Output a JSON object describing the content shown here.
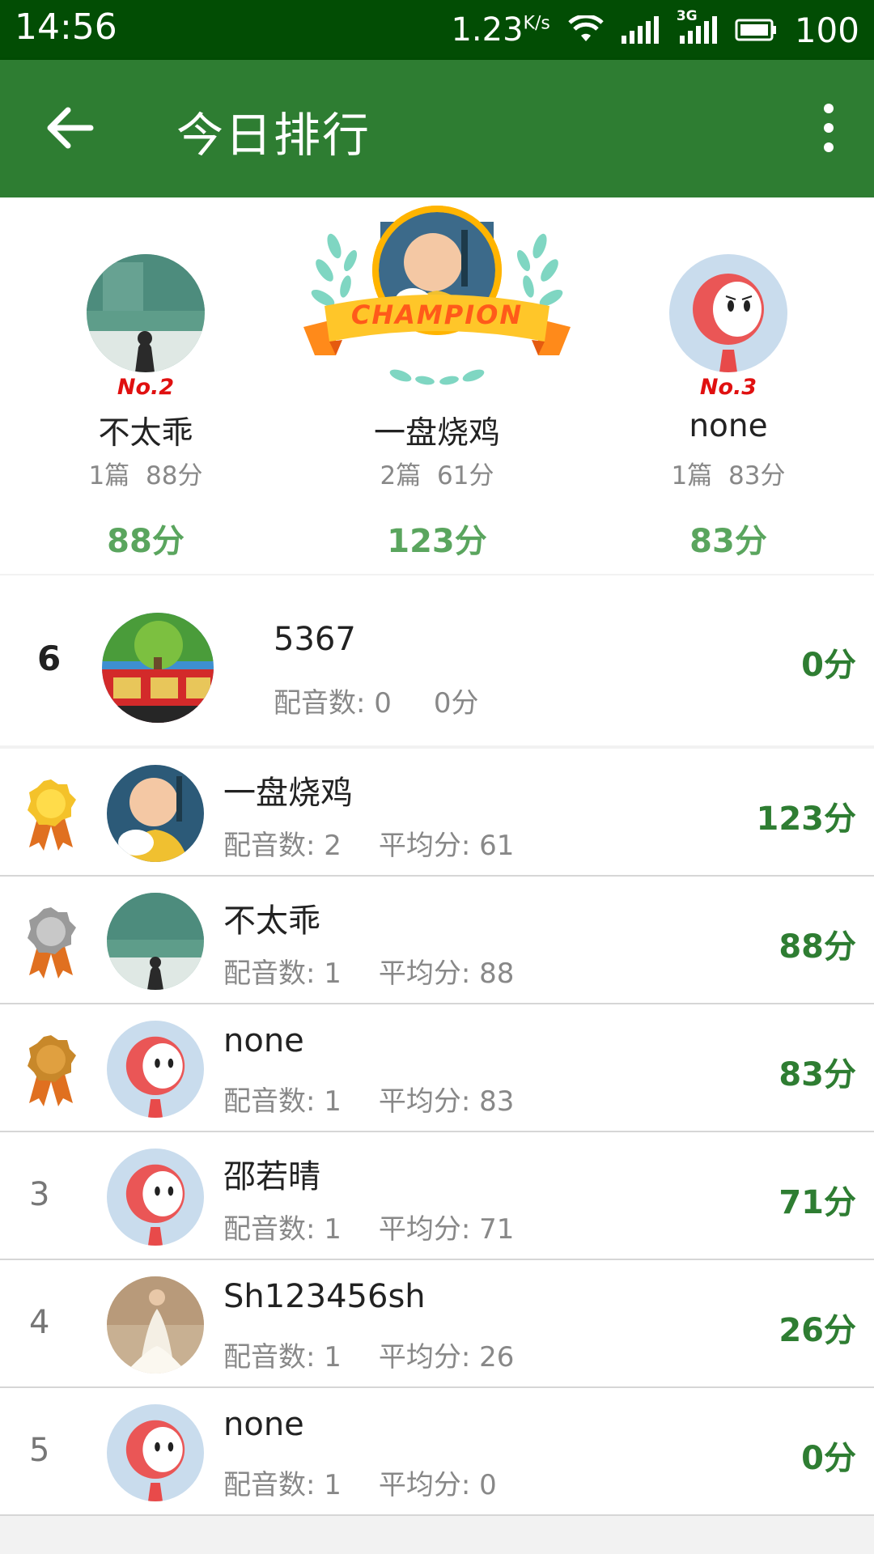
{
  "status_bar": {
    "time": "14:56",
    "net_speed": "1.23",
    "net_speed_unit": "K/s",
    "network_type": "3G",
    "battery": "100",
    "icons": [
      "wifi-icon",
      "signal-icon",
      "signal-3g-icon",
      "battery-icon"
    ]
  },
  "app_bar": {
    "title": "今日排行",
    "back_icon": "arrow-left-icon",
    "menu_icon": "more-vertical-icon"
  },
  "podium": {
    "second": {
      "tag": "No.2",
      "name": "不太乖",
      "works": "1篇",
      "avg": "88分",
      "score": "88分"
    },
    "first": {
      "badge": "CHAMPION",
      "name": "一盘烧鸡",
      "works": "2篇",
      "avg": "61分",
      "score": "123分"
    },
    "third": {
      "tag": "No.3",
      "name": "none",
      "works": "1篇",
      "avg": "83分",
      "score": "83分"
    }
  },
  "my_rank": {
    "rank": "6",
    "name": "5367",
    "count_label": "配音数:",
    "count": "0",
    "avg": "0分",
    "score": "0分"
  },
  "list": [
    {
      "rank": "1",
      "medal": "gold",
      "name": "一盘烧鸡",
      "count_text": "配音数: 2",
      "avg_text": "平均分: 61",
      "score": "123分"
    },
    {
      "rank": "2",
      "medal": "silver",
      "name": "不太乖",
      "count_text": "配音数: 1",
      "avg_text": "平均分: 88",
      "score": "88分"
    },
    {
      "rank": "3",
      "medal": "bronze",
      "name": "none",
      "count_text": "配音数: 1",
      "avg_text": "平均分: 83",
      "score": "83分"
    },
    {
      "rank": "3",
      "medal": "",
      "name": "邵若晴",
      "count_text": "配音数: 1",
      "avg_text": "平均分: 71",
      "score": "71分"
    },
    {
      "rank": "4",
      "medal": "",
      "name": "Sh123456sh",
      "count_text": "配音数: 1",
      "avg_text": "平均分: 26",
      "score": "26分"
    },
    {
      "rank": "5",
      "medal": "",
      "name": "none",
      "count_text": "配音数: 1",
      "avg_text": "平均分: 0",
      "score": "0分"
    }
  ],
  "colors": {
    "status_bar": "#024d04",
    "app_bar": "#2e7d32",
    "score_green": "#2e7d32",
    "podium_score_green": "#5aa55e",
    "rank_tag_red": "#e01010"
  }
}
